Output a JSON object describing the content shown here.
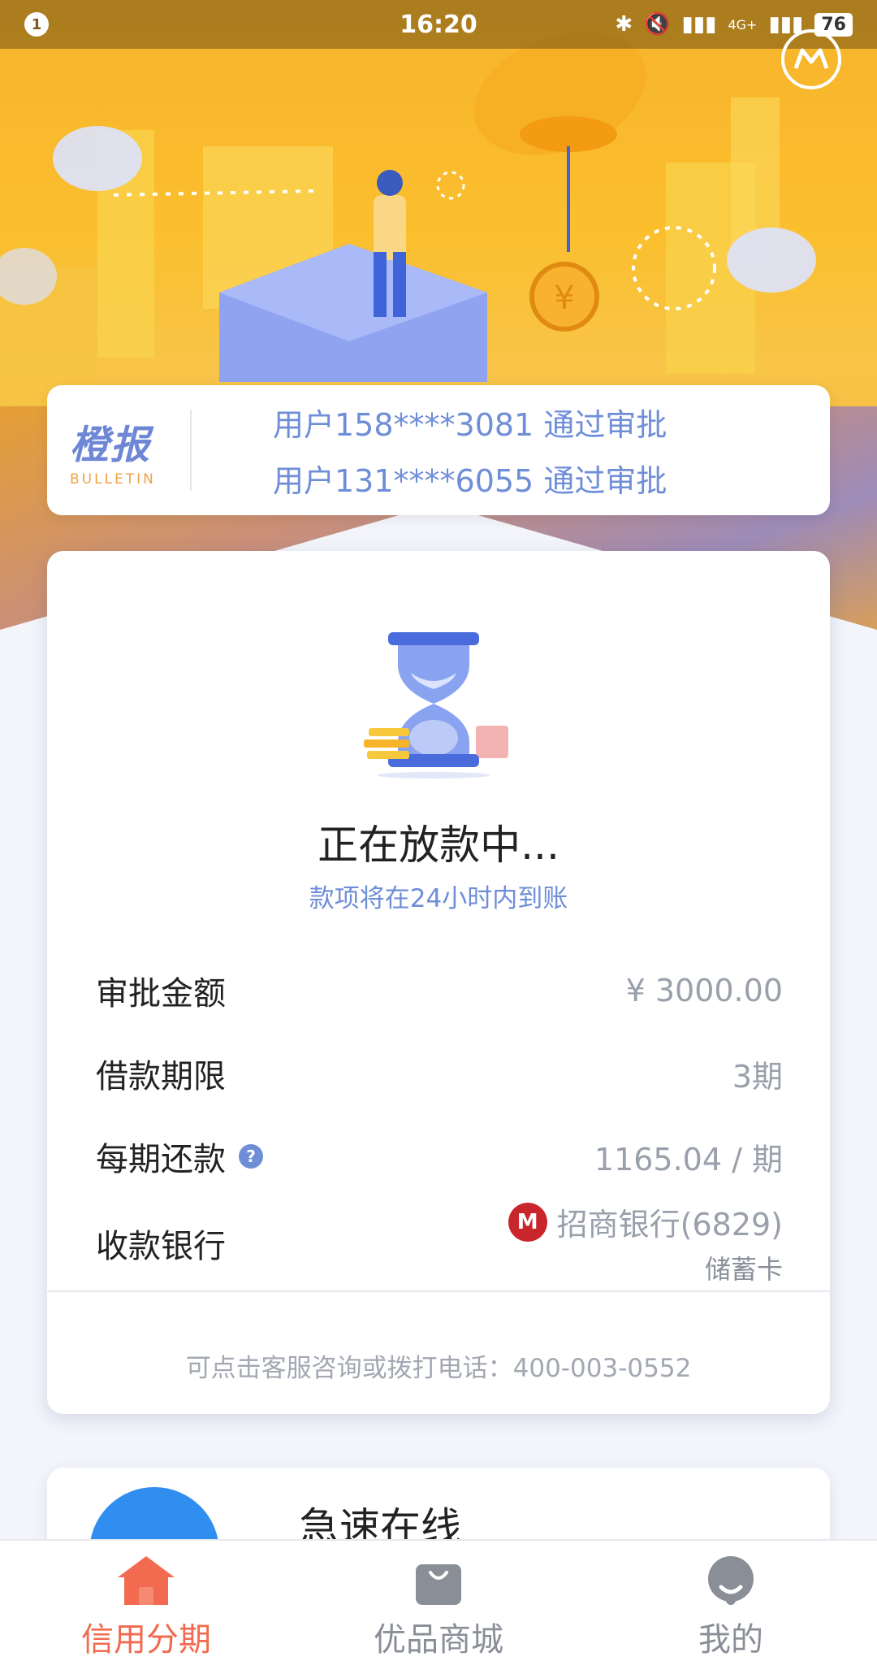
{
  "status_bar": {
    "notification_count": "1",
    "time": "16:20",
    "network": "4G+",
    "battery": "76"
  },
  "bulletin": {
    "logo_cn": "橙报",
    "logo_en": "BULLETIN",
    "lines": [
      "用户158****3081 通过审批",
      "用户131****6055 通过审批"
    ]
  },
  "loan_status": {
    "title": "正在放款中...",
    "subtitle": "款项将在24小时内到账",
    "rows": {
      "amount": {
        "label": "审批金额",
        "value": "¥ 3000.00"
      },
      "term": {
        "label": "借款期限",
        "value": "3期"
      },
      "installment": {
        "label": "每期还款",
        "value": "1165.04 / 期"
      },
      "bank": {
        "label": "收款银行",
        "value": "招商银行(6829)",
        "card_type": "储蓄卡"
      }
    },
    "contact": "可点击客服咨询或拨打电话：400-003-0552"
  },
  "next_card": {
    "title": "急速在线"
  },
  "bottom_nav": {
    "items": [
      {
        "label": "信用分期",
        "icon": "home-icon",
        "active": true
      },
      {
        "label": "优品商城",
        "icon": "shopping-bag-icon",
        "active": false
      },
      {
        "label": "我的",
        "icon": "profile-icon",
        "active": false
      }
    ]
  },
  "colors": {
    "accent": "#6f8ed8",
    "active_nav": "#f26a4f",
    "brand_orange": "#f7b32b"
  }
}
